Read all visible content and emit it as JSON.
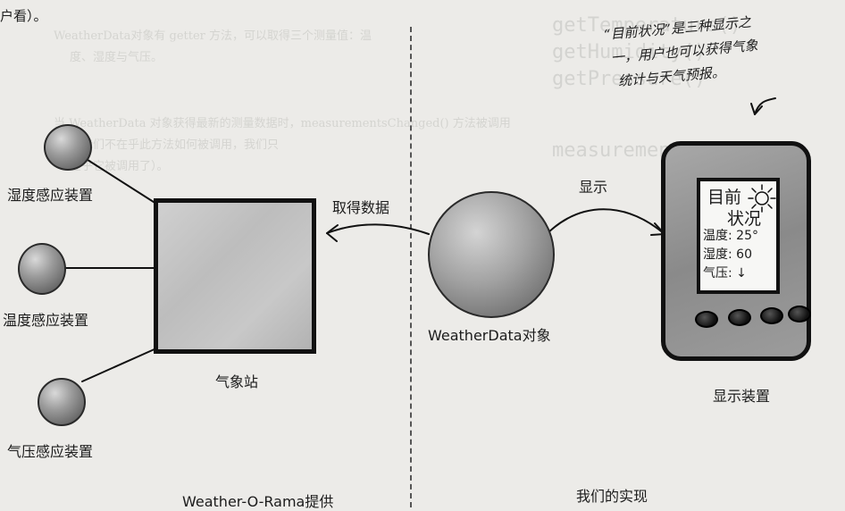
{
  "intro_fragment": "户看）。",
  "sensors": [
    {
      "label": "湿度感应装置"
    },
    {
      "label": "温度感应装置"
    },
    {
      "label": "气压感应装置"
    }
  ],
  "station_label": "气象站",
  "pull_label": "取得数据",
  "display_arrow_label": "显示",
  "weather_data_label": "WeatherData对象",
  "device_label": "显示装置",
  "device_screen": {
    "title_line1": "目前",
    "title_line2": "状况",
    "humidity_line": "温度: 25°",
    "temp_line": "湿度: 60",
    "pressure_line": "气压: ↓",
    "sun_icon": "sun-icon"
  },
  "annotation_lines": [
    "“目前状况”是三种显示之",
    "一，用户也可以获得气象",
    "统计与天气预报。"
  ],
  "provider_label": "Weather-O-Rama提供",
  "ours_label": "我们的实现"
}
